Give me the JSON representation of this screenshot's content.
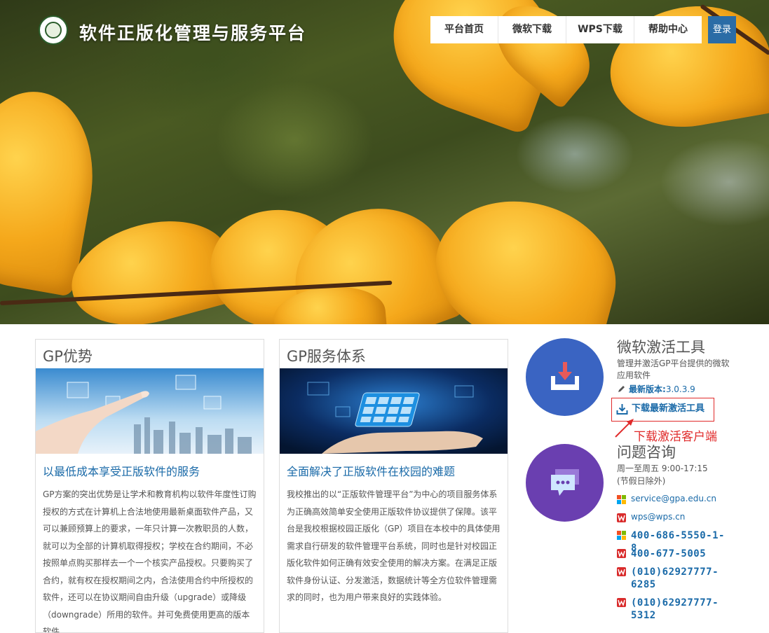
{
  "header": {
    "site_title": "软件正版化管理与服务平台",
    "nav": [
      "平台首页",
      "微软下载",
      "WPS下载",
      "帮助中心"
    ],
    "login": "登录"
  },
  "cards": [
    {
      "title": "GP优势",
      "subtitle": "以最低成本享受正版软件的服务",
      "body": "GP方案的突出优势是让学术和教育机构以软件年度性订购授权的方式在计算机上合法地使用最新桌面软件产品，又可以兼顾预算上的要求，一年只计算一次教职员的人数，就可以为全部的计算机取得授权；学校在合约期间，不必按照单点购买那样去一个一个核实产品授权。只要购买了合约，就有权在授权期间之内，合法使用合约中所授权的软件，还可以在协议期间自由升级（upgrade）或降级（downgrade）所用的软件。并可免费使用更高的版本软件。"
    },
    {
      "title": "GP服务体系",
      "subtitle": "全面解决了正版软件在校园的难题",
      "body": "我校推出的以“正版软件管理平台”为中心的项目服务体系为正确高效简单安全使用正版软件协议提供了保障。该平台是我校根据校园正版化（GP）项目在本校中的具体使用需求自行研发的软件管理平台系统，同时也是针对校园正版化软件如何正确有效安全使用的解决方案。在满足正版软件身份认证、分发激活，数据统计等全方位软件管理需求的同时，也为用户带来良好的实践体验。"
    }
  ],
  "activation": {
    "title": "微软激活工具",
    "desc": "管理并激活GP平台提供的微软应用软件",
    "version_label": "最新版本:",
    "version_value": "3.0.3.9",
    "download_link": "下载最新激活工具",
    "annotation": "下载激活客户端"
  },
  "consult": {
    "title": "问题咨询",
    "hours": "周一至周五 9:00-17:15",
    "holiday": "(节假日除外)",
    "contacts": [
      {
        "icon": "microsoft-icon",
        "text": "service@gpa.edu.cn"
      },
      {
        "icon": "wps-icon",
        "text": "wps@wps.cn"
      },
      {
        "icon": "microsoft-icon",
        "text": "400-686-5550-1-8"
      },
      {
        "icon": "wps-icon",
        "text": "400-677-5005"
      },
      {
        "icon": "wps-icon",
        "text": "(010)62927777-6285"
      },
      {
        "icon": "wps-icon",
        "text": "(010)62927777-5312"
      }
    ]
  },
  "colors": {
    "link_blue": "#1a6aa8",
    "login_bg": "#2a6ca6",
    "circle_blue": "#3a64c2",
    "circle_purple": "#6a3fb0",
    "annotation_red": "#e02a2a"
  }
}
